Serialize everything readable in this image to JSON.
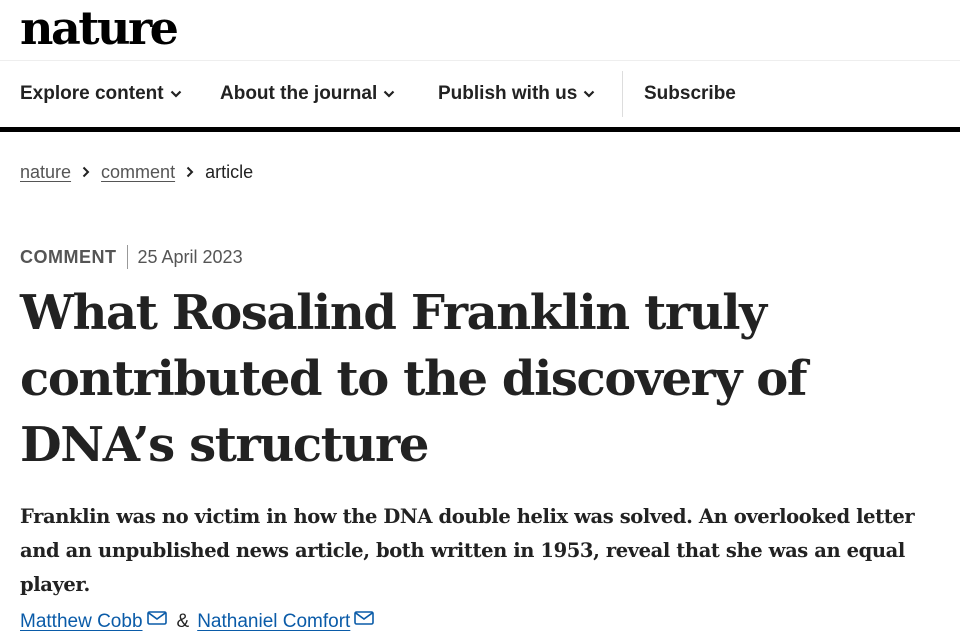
{
  "brand": {
    "logo": "nature"
  },
  "nav": {
    "items": [
      {
        "label": "Explore content",
        "icon": "chevron-down-icon"
      },
      {
        "label": "About the journal",
        "icon": "chevron-down-icon"
      },
      {
        "label": "Publish with us",
        "icon": "chevron-down-icon"
      }
    ],
    "subscribe": "Subscribe"
  },
  "breadcrumb": [
    "nature",
    "comment",
    "article"
  ],
  "article": {
    "type": "COMMENT",
    "date": "25 April 2023",
    "title": "What Rosalind Franklin truly contributed to the discovery of DNA’s structure",
    "standfirst": "Franklin was no victim in how the DNA double helix was solved. An overlooked letter and an unpublished news article, both written in 1953, reveal that she was an equal player.",
    "authors": [
      {
        "name": "Matthew Cobb",
        "icon": "mail-icon"
      },
      {
        "name": "Nathaniel Comfort",
        "icon": "mail-icon"
      }
    ],
    "author_separator": "&"
  },
  "colors": {
    "link": "#0a5ba8",
    "text": "#222222",
    "rule": "#000000"
  }
}
